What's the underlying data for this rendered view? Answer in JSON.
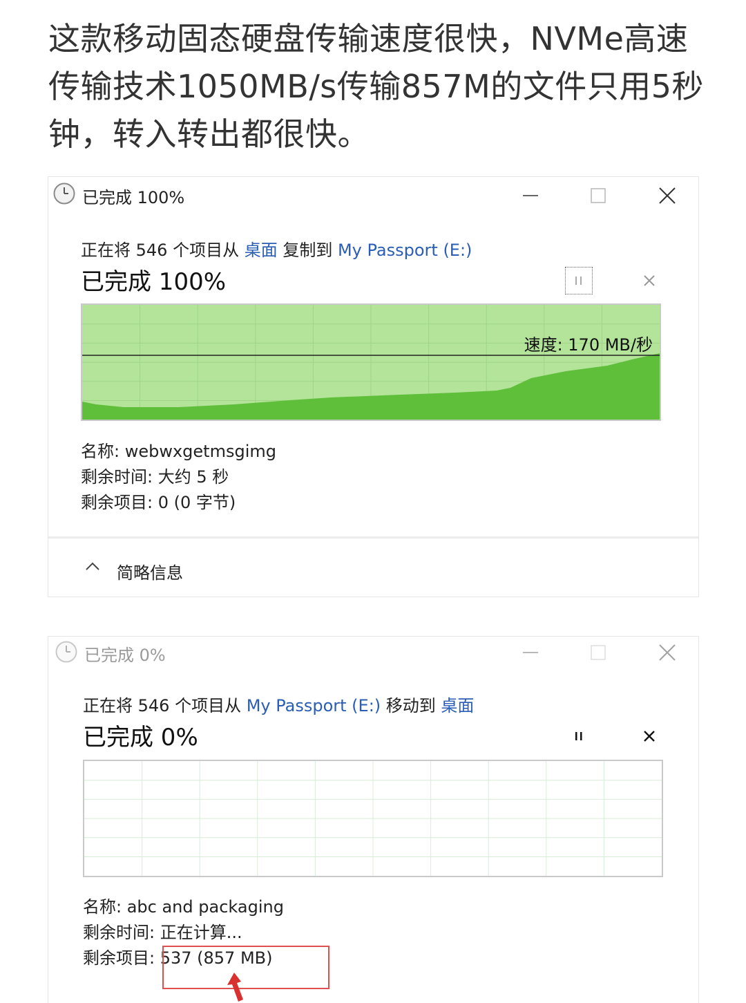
{
  "caption": "这款移动固态硬盘传输速度很快，NVMe高速传输技术1050MB/s传输857M的文件只用5秒钟，转入转出都很快。",
  "dialog1": {
    "window_title": "已完成 100%",
    "subtitle_prefix": "正在将 546 个项目从 ",
    "source_link": "桌面",
    "middle": " 复制到 ",
    "dest_link": "My Passport (E:)",
    "progress_title": "已完成 100%",
    "progress_percent": 100,
    "speed_label": "速度: 170 MB/秒",
    "name_row": "名称: webwxgetmsgimg",
    "time_row": "剩余时间: 大约 5 秒",
    "items_row": "剩余项目: 0 (0 字节)",
    "footer_label": "简略信息",
    "graph_color": "#5fbf3a",
    "graph_bg": "#b4e39a"
  },
  "dialog2": {
    "window_title": "已完成 0%",
    "subtitle_prefix": "正在将 546 个项目从 ",
    "source_link": "My Passport (E:)",
    "middle": " 移动到 ",
    "dest_link": "桌面",
    "progress_title": "已完成 0%",
    "progress_percent": 0,
    "name_row": "名称: abc and packaging",
    "time_row": "剩余时间: 正在计算...",
    "items_label": "剩余项目: ",
    "items_value": "537 (857 MB)",
    "highlight_color": "#e05050"
  },
  "icons": [
    "clock-icon",
    "minimize-icon",
    "maximize-icon",
    "close-icon",
    "pause-icon",
    "cancel-icon",
    "chevron-up-icon",
    "red-arrow-icon"
  ],
  "colors": {
    "link": "#2a5db5",
    "caption_text": "#333333"
  }
}
